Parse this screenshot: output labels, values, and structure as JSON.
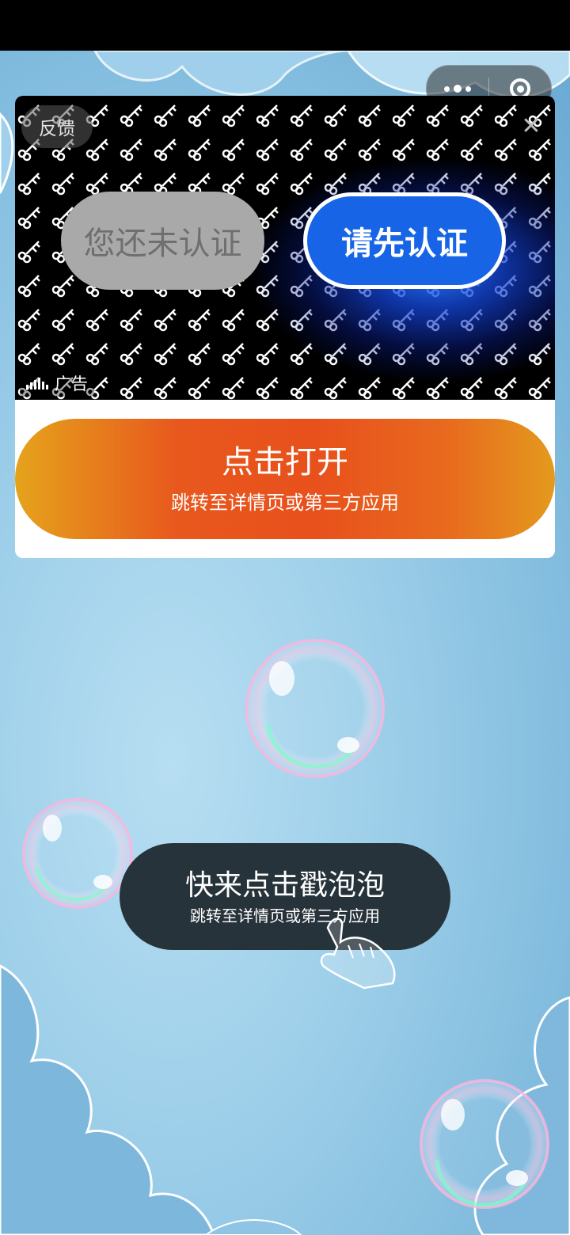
{
  "ad": {
    "feedback_label": "反馈",
    "close_icon": "close-icon",
    "ad_label": "广告",
    "image": {
      "grey_button_text": "您还未认证",
      "blue_button_text": "请先认证"
    },
    "cta": {
      "title": "点击打开",
      "subtitle": "跳转至详情页或第三方应用"
    }
  },
  "game": {
    "hint_title": "快来点击戳泡泡",
    "hint_subtitle": "跳转至详情页或第三方应用"
  },
  "colors": {
    "cta_orange": "#e8581d",
    "verify_blue": "#1764e6",
    "hint_bg": "#27333a"
  }
}
